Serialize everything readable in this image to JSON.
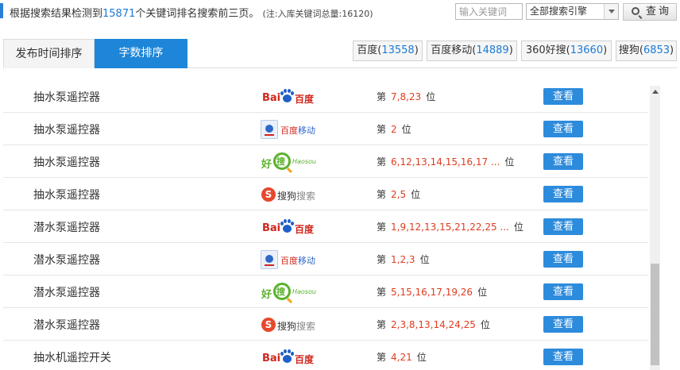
{
  "header": {
    "summary_prefix": "根据搜索结果检测到",
    "keyword_count": "15871",
    "summary_suffix": "个关键词排名搜索前三页。",
    "note": "(注:入库关键词总量:16120)",
    "keyword_input_placeholder": "输入关键词",
    "engine_select_value": "全部搜索引擎",
    "query_button_label": "查询",
    "colors": {
      "accent": "#1d86d8",
      "rank": "#e03c1f"
    }
  },
  "tabs": {
    "sort_by_time": "发布时间排序",
    "sort_by_words": "字数排序"
  },
  "engine_filters": [
    {
      "name": "百度",
      "count": "13558"
    },
    {
      "name": "百度移动",
      "count": "14889"
    },
    {
      "name": "360好搜",
      "count": "13660"
    },
    {
      "name": "搜狗",
      "count": "6853"
    }
  ],
  "logos": {
    "baidu_left": "Bai",
    "baidu_right": "百度",
    "mobile_red": "百度",
    "mobile_blue": "移动",
    "haosou_cn": "好",
    "haosou_ring": "搜",
    "haosou_en": "Haosou",
    "sogou_mark": "S",
    "sogou_name": "搜狗",
    "sogou_suffix": "搜索"
  },
  "rank_prefix": "第",
  "rank_suffix": "位",
  "view_label": "查看",
  "rows": [
    {
      "keyword": "抽水泵遥控器",
      "engine": "baidu-icon",
      "positions": "7,8,23"
    },
    {
      "keyword": "抽水泵遥控器",
      "engine": "baidu-mobile-icon",
      "positions": "2"
    },
    {
      "keyword": "抽水泵遥控器",
      "engine": "haosou-icon",
      "positions": "6,12,13,14,15,16,17 ..."
    },
    {
      "keyword": "抽水泵遥控器",
      "engine": "sogou-icon",
      "positions": "2,5"
    },
    {
      "keyword": "潜水泵遥控器",
      "engine": "baidu-icon",
      "positions": "1,9,12,13,15,21,22,25 ..."
    },
    {
      "keyword": "潜水泵遥控器",
      "engine": "baidu-mobile-icon",
      "positions": "1,2,3"
    },
    {
      "keyword": "潜水泵遥控器",
      "engine": "haosou-icon",
      "positions": "5,15,16,17,19,26"
    },
    {
      "keyword": "潜水泵遥控器",
      "engine": "sogou-icon",
      "positions": "2,3,8,13,14,24,25"
    },
    {
      "keyword": "抽水机遥控开关",
      "engine": "baidu-icon",
      "positions": "4,21"
    }
  ]
}
